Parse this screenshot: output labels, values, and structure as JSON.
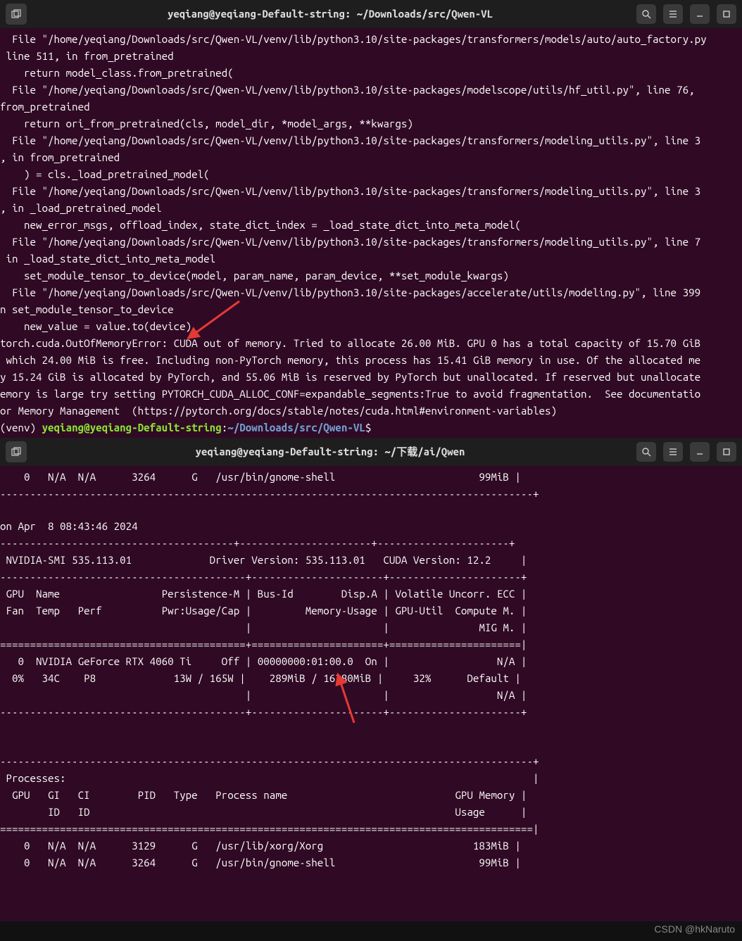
{
  "win1": {
    "title": "yeqiang@yeqiang-Default-string: ~/Downloads/src/Qwen-VL",
    "lines": [
      "  File \"/home/yeqiang/Downloads/src/Qwen-VL/venv/lib/python3.10/site-packages/transformers/models/auto/auto_factory.py",
      " line 511, in from_pretrained",
      "    return model_class.from_pretrained(",
      "  File \"/home/yeqiang/Downloads/src/Qwen-VL/venv/lib/python3.10/site-packages/modelscope/utils/hf_util.py\", line 76, ",
      "from_pretrained",
      "    return ori_from_pretrained(cls, model_dir, *model_args, **kwargs)",
      "  File \"/home/yeqiang/Downloads/src/Qwen-VL/venv/lib/python3.10/site-packages/transformers/modeling_utils.py\", line 3",
      ", in from_pretrained",
      "    ) = cls._load_pretrained_model(",
      "  File \"/home/yeqiang/Downloads/src/Qwen-VL/venv/lib/python3.10/site-packages/transformers/modeling_utils.py\", line 3",
      ", in _load_pretrained_model",
      "    new_error_msgs, offload_index, state_dict_index = _load_state_dict_into_meta_model(",
      "  File \"/home/yeqiang/Downloads/src/Qwen-VL/venv/lib/python3.10/site-packages/transformers/modeling_utils.py\", line 7",
      " in _load_state_dict_into_meta_model",
      "    set_module_tensor_to_device(model, param_name, param_device, **set_module_kwargs)",
      "  File \"/home/yeqiang/Downloads/src/Qwen-VL/venv/lib/python3.10/site-packages/accelerate/utils/modeling.py\", line 399",
      "n set_module_tensor_to_device",
      "    new_value = value.to(device)",
      "torch.cuda.OutOfMemoryError: CUDA out of memory. Tried to allocate 26.00 MiB. GPU 0 has a total capacity of 15.70 GiB",
      " which 24.00 MiB is free. Including non-PyTorch memory, this process has 15.41 GiB memory in use. Of the allocated me",
      "y 15.24 GiB is allocated by PyTorch, and 55.06 MiB is reserved by PyTorch but unallocated. If reserved but unallocate",
      "emory is large try setting PYTORCH_CUDA_ALLOC_CONF=expandable_segments:True to avoid fragmentation.  See documentatio",
      "or Memory Management  (https://pytorch.org/docs/stable/notes/cuda.html#environment-variables)"
    ],
    "prompt_prefix": "(venv) ",
    "prompt_user": "yeqiang@yeqiang-Default-string",
    "prompt_sep": ":",
    "prompt_path": "~/Downloads/src/Qwen-VL",
    "prompt_suffix": "$"
  },
  "win2": {
    "title": "yeqiang@yeqiang-Default-string: ~/下载/ai/Qwen",
    "lines": [
      "    0   N/A  N/A      3264      G   /usr/bin/gnome-shell                        99MiB |",
      "-----------------------------------------------------------------------------------------+",
      "on Apr  8 08:43:46 2024",
      "---------------------------------------+----------------------+----------------------+",
      " NVIDIA-SMI 535.113.01             Driver Version: 535.113.01   CUDA Version: 12.2     |",
      "-----------------------------------------+----------------------+----------------------+",
      " GPU  Name                 Persistence-M | Bus-Id        Disp.A | Volatile Uncorr. ECC |",
      " Fan  Temp   Perf          Pwr:Usage/Cap |         Memory-Usage | GPU-Util  Compute M. |",
      "                                         |                      |               MIG M. |",
      "=========================================+======================+======================|",
      "   0  NVIDIA GeForce RTX 4060 Ti     Off | 00000000:01:00.0  On |                  N/A |",
      "  0%   34C    P8             13W / 165W |    289MiB / 16380MiB |     32%      Default |",
      "                                         |                      |                  N/A |",
      "-----------------------------------------+----------------------+----------------------+",
      "                                                                                         ",
      "-----------------------------------------------------------------------------------------+",
      " Processes:                                                                              |",
      "  GPU   GI   CI        PID   Type   Process name                            GPU Memory |",
      "        ID   ID                                                             Usage      |",
      "=========================================================================================|",
      "    0   N/A  N/A      3129      G   /usr/lib/xorg/Xorg                         183MiB |",
      "    0   N/A  N/A      3264      G   /usr/bin/gnome-shell                        99MiB |"
    ]
  },
  "watermark": "CSDN @hkNaruto"
}
